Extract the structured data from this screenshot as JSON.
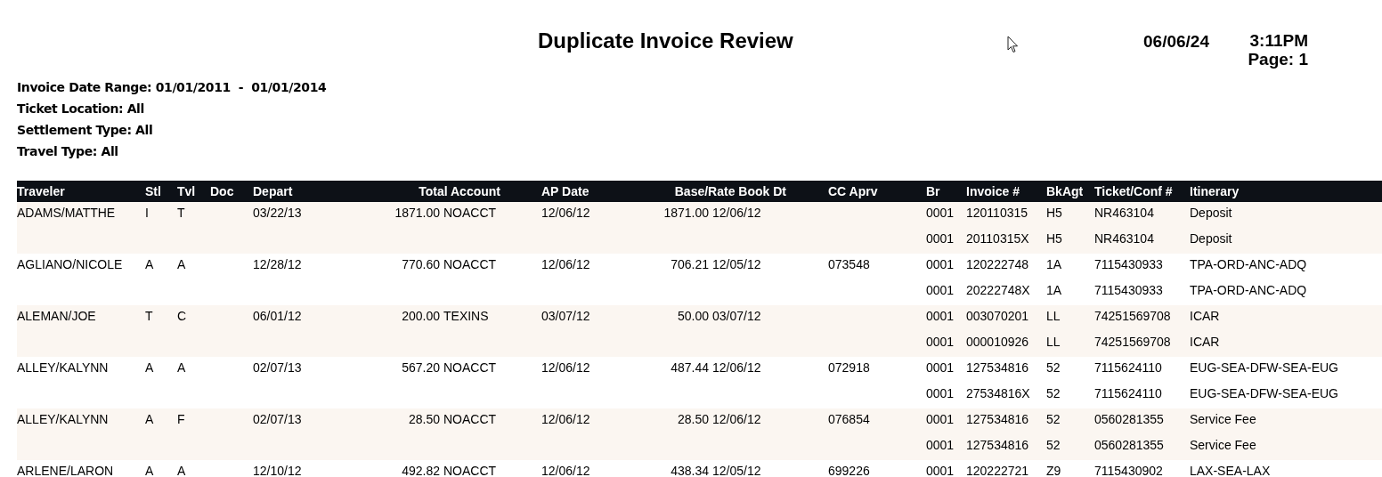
{
  "report": {
    "title": "Duplicate Invoice Review",
    "date": "06/06/24",
    "time": "3:11PM",
    "page": "Page: 1"
  },
  "filters": [
    "Invoice Date Range: 01/01/2011  -  01/01/2014",
    "Ticket Location: All",
    "Settlement Type: All",
    "Travel Type: All"
  ],
  "table": {
    "columns": [
      "Traveler",
      "Stl",
      "Tvl",
      "Doc",
      "Depart",
      "Total Account",
      "AP Date",
      "Base/Rate Book Dt",
      "CC Aprv",
      "Br",
      "Invoice #",
      "BkAgt",
      "Ticket/Conf #",
      "Itinerary"
    ],
    "groups": [
      {
        "traveler": "ADAMS/MATTHE",
        "stl": "I",
        "tvl": "T",
        "depart": "03/22/13",
        "total": "1871.00",
        "account": "NOACCT",
        "ap_date": "12/06/12",
        "base": "1871.00",
        "book_dt": "12/06/12",
        "lines": [
          {
            "br": "0001",
            "invoice": "120110315",
            "bkagt": "H5",
            "ticket": "NR463104",
            "itinerary": "Deposit"
          },
          {
            "br": "0001",
            "invoice": "20110315X",
            "bkagt": "H5",
            "ticket": "NR463104",
            "itinerary": "Deposit"
          }
        ]
      },
      {
        "traveler": "AGLIANO/NICOLE",
        "stl": "A",
        "tvl": "A",
        "depart": "12/28/12",
        "total": "770.60",
        "account": "NOACCT",
        "ap_date": "12/06/12",
        "base": "706.21",
        "book_dt": "12/05/12",
        "cc_aprv": "073548",
        "lines": [
          {
            "br": "0001",
            "invoice": "120222748",
            "bkagt": "1A",
            "ticket": "7115430933",
            "itinerary": "TPA-ORD-ANC-ADQ"
          },
          {
            "br": "0001",
            "invoice": "20222748X",
            "bkagt": "1A",
            "ticket": "7115430933",
            "itinerary": "TPA-ORD-ANC-ADQ"
          }
        ]
      },
      {
        "traveler": "ALEMAN/JOE",
        "stl": "T",
        "tvl": "C",
        "depart": "06/01/12",
        "total": "200.00",
        "account": "TEXINS",
        "ap_date": "03/07/12",
        "base": "50.00",
        "book_dt": "03/07/12",
        "lines": [
          {
            "br": "0001",
            "invoice": "003070201",
            "bkagt": "LL",
            "ticket": "74251569708",
            "itinerary": "ICAR"
          },
          {
            "br": "0001",
            "invoice": "000010926",
            "bkagt": "LL",
            "ticket": "74251569708",
            "itinerary": "ICAR"
          }
        ]
      },
      {
        "traveler": "ALLEY/KALYNN",
        "stl": "A",
        "tvl": "A",
        "depart": "02/07/13",
        "total": "567.20",
        "account": "NOACCT",
        "ap_date": "12/06/12",
        "base": "487.44",
        "book_dt": "12/06/12",
        "cc_aprv": "072918",
        "lines": [
          {
            "br": "0001",
            "invoice": "127534816",
            "bkagt": "52",
            "ticket": "7115624110",
            "itinerary": "EUG-SEA-DFW-SEA-EUG"
          },
          {
            "br": "0001",
            "invoice": "27534816X",
            "bkagt": "52",
            "ticket": "7115624110",
            "itinerary": "EUG-SEA-DFW-SEA-EUG"
          }
        ]
      },
      {
        "traveler": "ALLEY/KALYNN",
        "stl": "A",
        "tvl": "F",
        "depart": "02/07/13",
        "total": "28.50",
        "account": "NOACCT",
        "ap_date": "12/06/12",
        "base": "28.50",
        "book_dt": "12/06/12",
        "cc_aprv": "076854",
        "lines": [
          {
            "br": "0001",
            "invoice": "127534816",
            "bkagt": "52",
            "ticket": "0560281355",
            "itinerary": "Service Fee"
          },
          {
            "br": "0001",
            "invoice": "127534816",
            "bkagt": "52",
            "ticket": "0560281355",
            "itinerary": "Service Fee"
          }
        ]
      },
      {
        "traveler": "ARLENE/LARON",
        "stl": "A",
        "tvl": "A",
        "depart": "12/10/12",
        "total": "492.82",
        "account": "NOACCT",
        "ap_date": "12/06/12",
        "base": "438.34",
        "book_dt": "12/05/12",
        "cc_aprv": "699226",
        "lines": [
          {
            "br": "0001",
            "invoice": "120222721",
            "bkagt": "Z9",
            "ticket": "7115430902",
            "itinerary": "LAX-SEA-LAX"
          }
        ]
      }
    ]
  }
}
